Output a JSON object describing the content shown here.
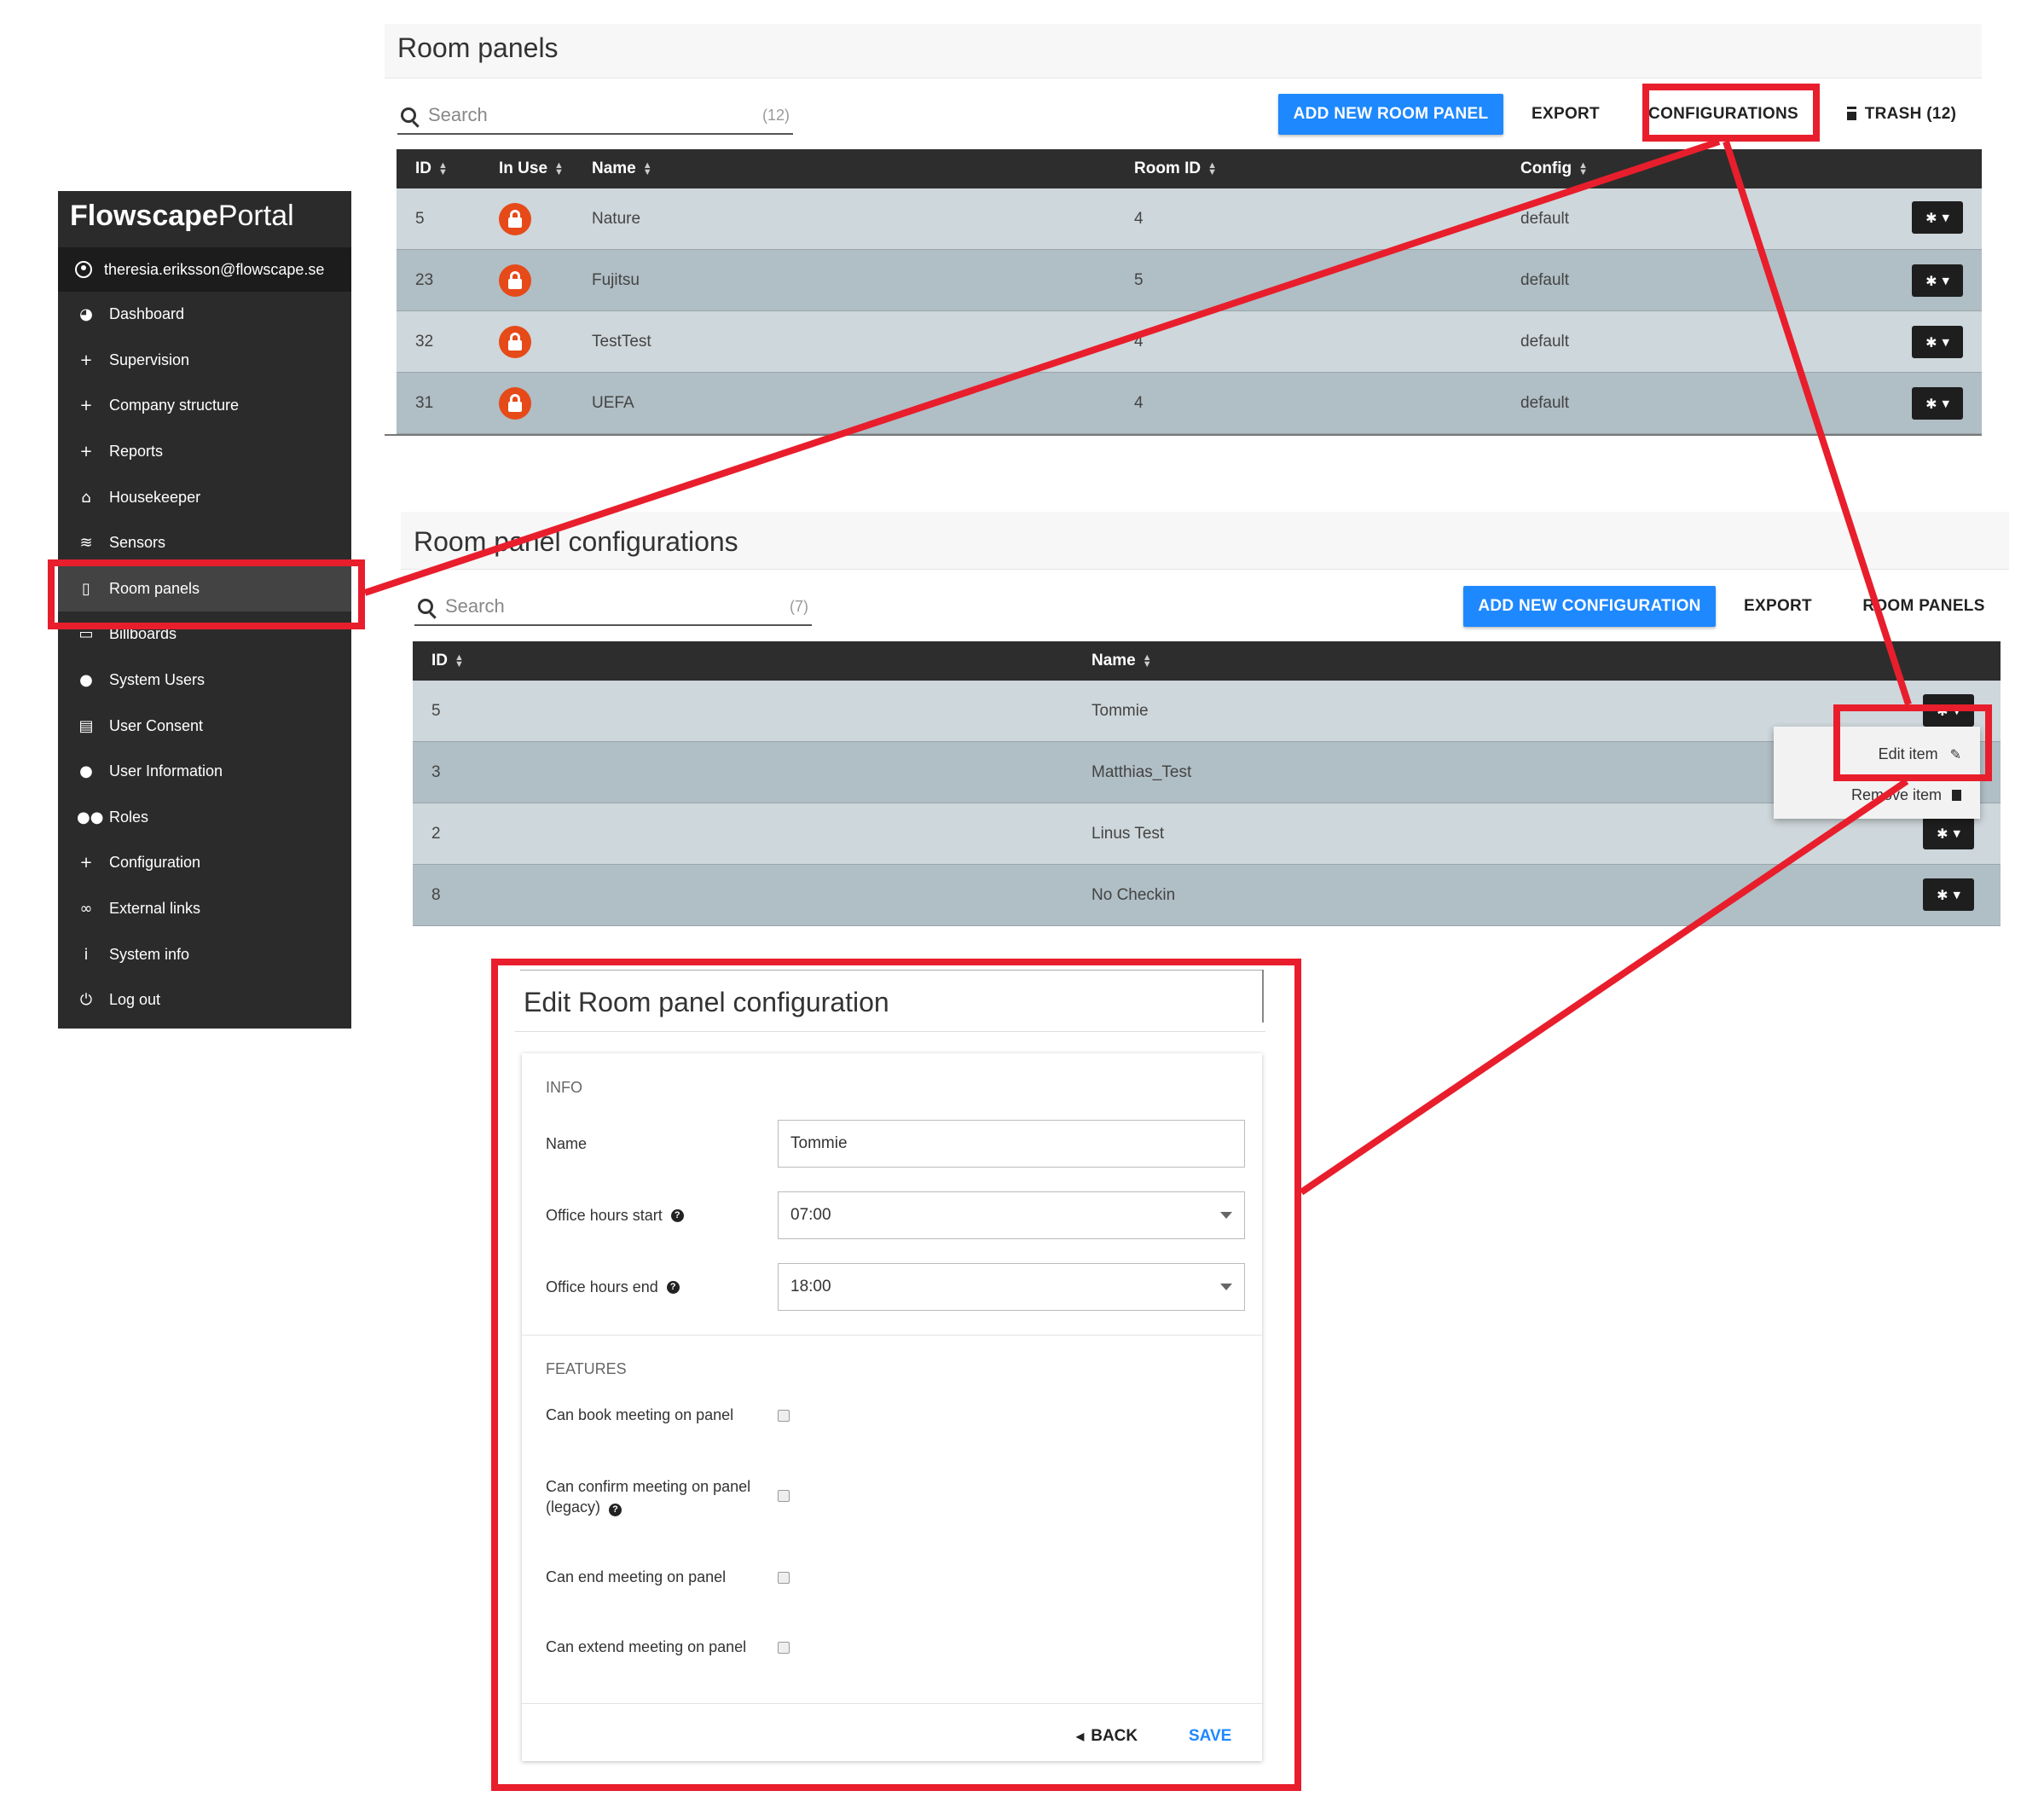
{
  "sidebar": {
    "brand_bold": "Flowscape",
    "brand_light": "Portal",
    "user_email": "theresia.eriksson@flowscape.se",
    "items": [
      {
        "label": "Dashboard",
        "icon": "dashboard-icon",
        "glyph": "◕"
      },
      {
        "label": "Supervision",
        "icon": "plus-icon",
        "glyph": "+"
      },
      {
        "label": "Company structure",
        "icon": "plus-icon",
        "glyph": "+"
      },
      {
        "label": "Reports",
        "icon": "plus-icon",
        "glyph": "+"
      },
      {
        "label": "Housekeeper",
        "icon": "home-icon",
        "glyph": "⌂"
      },
      {
        "label": "Sensors",
        "icon": "wifi-icon",
        "glyph": "≋"
      },
      {
        "label": "Room panels",
        "icon": "tablet-icon",
        "glyph": "▯",
        "active": true
      },
      {
        "label": "Billboards",
        "icon": "monitor-icon",
        "glyph": "▭"
      },
      {
        "label": "System Users",
        "icon": "user-icon",
        "glyph": "●"
      },
      {
        "label": "User Consent",
        "icon": "document-icon",
        "glyph": "▤"
      },
      {
        "label": "User Information",
        "icon": "user-icon",
        "glyph": "●"
      },
      {
        "label": "Roles",
        "icon": "users-icon",
        "glyph": "●●"
      },
      {
        "label": "Configuration",
        "icon": "plus-icon",
        "glyph": "+"
      },
      {
        "label": "External links",
        "icon": "link-icon",
        "glyph": "∞"
      },
      {
        "label": "System info",
        "icon": "info-icon",
        "glyph": "i"
      },
      {
        "label": "Log out",
        "icon": "power-icon",
        "glyph": "⏻"
      }
    ]
  },
  "room_panels": {
    "title": "Room panels",
    "search": {
      "placeholder": "Search",
      "count": "(12)"
    },
    "add_button": "ADD NEW ROOM PANEL",
    "export_button": "EXPORT",
    "configurations_button": "CONFIGURATIONS",
    "trash_button": "TRASH (12)",
    "columns": [
      "ID",
      "In Use",
      "Name",
      "Room ID",
      "Config"
    ],
    "rows": [
      {
        "id": "5",
        "name": "Nature",
        "room_id": "4",
        "config": "default"
      },
      {
        "id": "23",
        "name": "Fujitsu",
        "room_id": "5",
        "config": "default"
      },
      {
        "id": "32",
        "name": "TestTest",
        "room_id": "4",
        "config": "default"
      },
      {
        "id": "31",
        "name": "UEFA",
        "room_id": "4",
        "config": "default"
      }
    ]
  },
  "configurations": {
    "title": "Room panel configurations",
    "search": {
      "placeholder": "Search",
      "count": "(7)"
    },
    "add_button": "ADD NEW CONFIGURATION",
    "export_button": "EXPORT",
    "room_panels_button": "ROOM PANELS",
    "columns": [
      "ID",
      "Name"
    ],
    "rows": [
      {
        "id": "5",
        "name": "Tommie"
      },
      {
        "id": "3",
        "name": "Matthias_Test"
      },
      {
        "id": "2",
        "name": "Linus Test"
      },
      {
        "id": "8",
        "name": "No Checkin"
      }
    ],
    "row_menu": {
      "edit": "Edit item",
      "remove": "Remove item"
    }
  },
  "edit_form": {
    "title": "Edit Room panel configuration",
    "info_label": "INFO",
    "name_label": "Name",
    "name_value": "Tommie",
    "office_start_label": "Office hours start",
    "office_start_value": "07:00",
    "office_end_label": "Office hours end",
    "office_end_value": "18:00",
    "features_label": "FEATURES",
    "features": [
      {
        "label": "Can book meeting on panel",
        "checked": false
      },
      {
        "label": "Can confirm meeting on panel (legacy)",
        "checked": false
      },
      {
        "label": "Can end meeting on panel",
        "checked": false
      },
      {
        "label": "Can extend meeting on panel",
        "checked": false
      }
    ],
    "back_button": "BACK",
    "save_button": "SAVE"
  },
  "colors": {
    "primary": "#1e88ff",
    "highlight": "#e81e2c",
    "lock": "#e64a19",
    "table_header": "#2d2d2d",
    "sidebar": "#2b2b2b"
  }
}
